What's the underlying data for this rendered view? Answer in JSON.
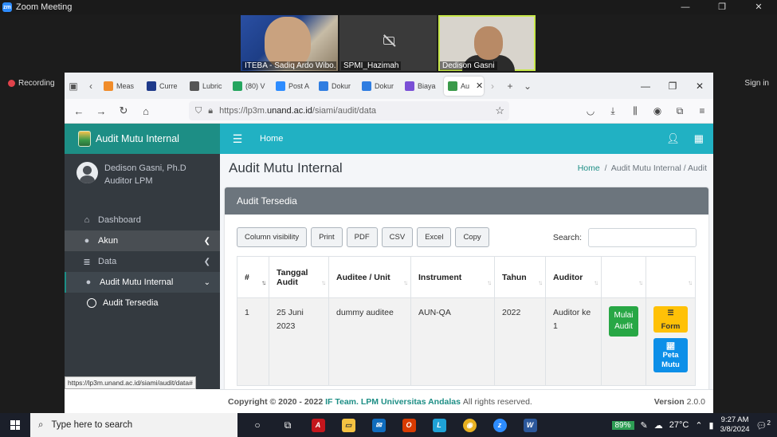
{
  "zoom": {
    "title": "Zoom Meeting",
    "recording_label": "Recording",
    "signin_label": "Sign in",
    "participants": [
      "ITEBA - Sadiq Ardo Wibo...",
      "SPMI_Hazimah",
      "Dedison Gasni"
    ]
  },
  "browser": {
    "tabs": [
      {
        "label": "Meas",
        "icon": "e-icon",
        "color": "#f08c2a"
      },
      {
        "label": "Curre",
        "icon": "i-icon",
        "color": "#1e3a8a"
      },
      {
        "label": "Lubric",
        "icon": "lock-icon",
        "color": "#555555"
      },
      {
        "label": "(80) V",
        "icon": "chat-icon",
        "color": "#25a55f"
      },
      {
        "label": "Post A",
        "icon": "zoom-icon",
        "color": "#2d8cff"
      },
      {
        "label": "Dokur",
        "icon": "cloud-icon",
        "color": "#2f7de1"
      },
      {
        "label": "Dokur",
        "icon": "cloud-icon",
        "color": "#2f7de1"
      },
      {
        "label": "Biaya",
        "icon": "shield-icon",
        "color": "#7a4fd6"
      },
      {
        "label": "Au",
        "icon": "app-icon",
        "color": "#3a9a4a"
      }
    ],
    "url_prefix": "https://lp3m.",
    "url_host": "unand.ac.id",
    "url_path": "/siami/audit/data",
    "status_url": "https://lp3m.unand.ac.id/siami/audit/data#"
  },
  "app": {
    "brand": "Audit Mutu Internal",
    "topbar_home": "Home",
    "user_name": "Dedison Gasni, Ph.D",
    "user_role": "Auditor LPM",
    "menu": [
      {
        "label": "Dashboard",
        "icon": "tachometer-icon"
      },
      {
        "label": "Akun",
        "icon": "user-icon"
      },
      {
        "label": "Data",
        "icon": "database-icon"
      },
      {
        "label": "Audit Mutu Internal",
        "icon": "user-cog-icon"
      }
    ],
    "submenu": {
      "label": "Audit Tersedia"
    },
    "page_title": "Audit Mutu Internal",
    "breadcrumb_home": "Home",
    "breadcrumb_current": "Audit Mutu Internal / Audit",
    "card_title": "Audit Tersedia",
    "toolbar": {
      "column_visibility": "Column visibility",
      "print": "Print",
      "pdf": "PDF",
      "csv": "CSV",
      "excel": "Excel",
      "copy": "Copy",
      "search_label": "Search:"
    },
    "table": {
      "headers": [
        "#",
        "Tanggal Audit",
        "Auditee / Unit",
        "Instrument",
        "Tahun",
        "Auditor",
        "",
        ""
      ],
      "rows": [
        {
          "no": "1",
          "tanggal": "25 Juni 2023",
          "auditee": "dummy auditee",
          "instrument": "AUN-QA",
          "tahun": "2022",
          "auditor": "Auditor ke 1"
        }
      ],
      "btn_mulai": "Mulai Audit",
      "btn_form": "Form",
      "btn_peta": "Peta Mutu"
    },
    "footer": {
      "copyright": "Copyright © 2020 - 2022",
      "team": "IF Team.",
      "org": "LPM Universitas Andalas",
      "rights": "All rights reserved.",
      "version_label": "Version",
      "version": "2.0.0"
    }
  },
  "taskbar": {
    "search_placeholder": "Type here to search",
    "battery": "89%",
    "temperature": "27°C",
    "time": "9:27 AM",
    "date": "3/8/2024",
    "notification_count": "2"
  }
}
